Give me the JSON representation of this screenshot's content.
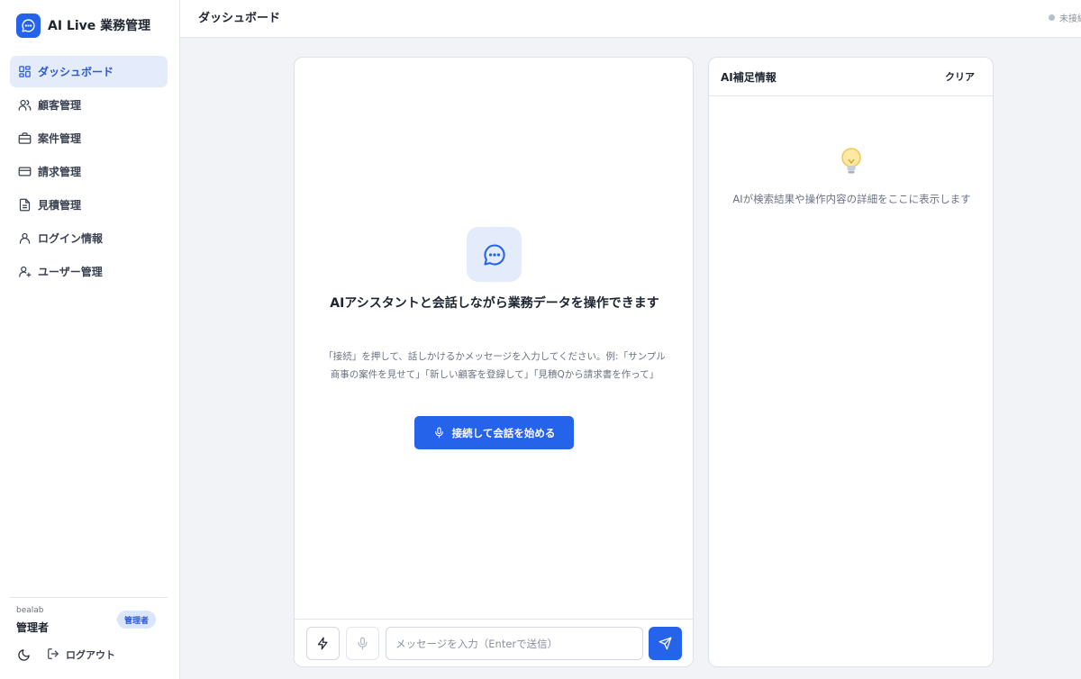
{
  "app": {
    "title": "AI Live 業務管理"
  },
  "sidebar": {
    "items": [
      {
        "label": "ダッシュボード",
        "icon": "dashboard-grid-icon",
        "active": true
      },
      {
        "label": "顧客管理",
        "icon": "users-icon",
        "active": false
      },
      {
        "label": "案件管理",
        "icon": "briefcase-icon",
        "active": false
      },
      {
        "label": "請求管理",
        "icon": "credit-card-icon",
        "active": false
      },
      {
        "label": "見積管理",
        "icon": "document-icon",
        "active": false
      },
      {
        "label": "ログイン情報",
        "icon": "user-icon",
        "active": false
      },
      {
        "label": "ユーザー管理",
        "icon": "user-plus-icon",
        "active": false
      }
    ],
    "user": {
      "org": "bealab",
      "name": "管理者",
      "role": "管理者"
    },
    "logout_label": "ログアウト"
  },
  "header": {
    "title": "ダッシュボード",
    "status": "未接続"
  },
  "chat": {
    "empty_title": "AIアシスタントと会話しながら業務データを操作できます",
    "empty_desc": "「接続」を押して、話しかけるかメッセージを入力してください。例:「サンプル商事の案件を見せて」「新しい顧客を登録して」「見積Qから請求書を作って」",
    "start_button": "接続して会話を始める",
    "input_placeholder": "メッセージを入力（Enterで送信）",
    "input_value": ""
  },
  "info_panel": {
    "title": "AI補足情報",
    "clear_label": "クリア",
    "empty_text": "AIが検索結果や操作内容の詳細をここに表示します"
  },
  "colors": {
    "accent": "#2563eb",
    "active_bg": "#e4ebfa",
    "page_bg": "#f1f3f7"
  }
}
